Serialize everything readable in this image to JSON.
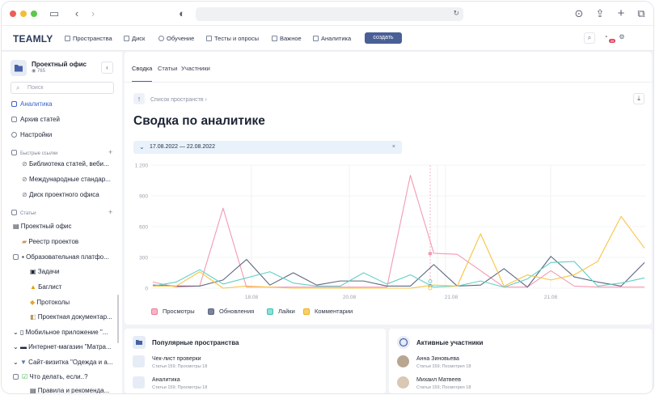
{
  "app": {
    "logo": "TEAMLY",
    "create": "создать"
  },
  "nav": [
    "Пространства",
    "Диск",
    "Обучение",
    "Тесты и опросы",
    "Важное",
    "Аналитика"
  ],
  "badge": "35",
  "sidebar": {
    "space_title": "Проектный офис",
    "space_views": "765",
    "search_placeholder": "Поиск",
    "analytics": "Аналитика",
    "archive": "Архив статей",
    "settings": "Настройки",
    "quick_links": "Быстрые ссылки",
    "links": [
      "Библиотека статей, веби...",
      "Международные стандар...",
      "Диск проектного офиса"
    ],
    "articles": "Статьи",
    "tree": [
      "Проектный офис",
      "Реестр проектов",
      "Образовательная платфо...",
      "Задачи",
      "Баглист",
      "Протоколы",
      "Проектная документар...",
      "Мобильное приложение \"...",
      "Интернет-магазин \"Матра...",
      "Сайт-визитка \"Одежда и а...",
      "Что делать, если..?",
      "Правила и рекоменда..."
    ]
  },
  "tabs": [
    "Сводка",
    "Статьи",
    "Участники"
  ],
  "breadcrumb": "Список пространств",
  "page_title": "Сводка по аналитике",
  "date_range": "17.08.2022 — 22.08.2022",
  "chart_data": {
    "type": "line",
    "ylim": [
      0,
      1200
    ],
    "yticks": [
      "1 200",
      "900",
      "600",
      "300",
      "0"
    ],
    "xticks": [
      "18.08",
      "20.08",
      "21.08",
      "21.08"
    ],
    "series": [
      {
        "name": "Просмотры",
        "color": "#f39ab2",
        "values": [
          60,
          10,
          20,
          780,
          10,
          10,
          10,
          10,
          10,
          10,
          10,
          1100,
          340,
          330,
          170,
          10,
          10,
          170,
          20,
          10,
          10,
          10
        ]
      },
      {
        "name": "Обновления",
        "color": "#5d6780",
        "values": [
          30,
          20,
          20,
          80,
          280,
          30,
          150,
          30,
          70,
          70,
          20,
          20,
          230,
          20,
          30,
          190,
          10,
          310,
          110,
          60,
          20,
          250
        ]
      },
      {
        "name": "Лайки",
        "color": "#63d0c4",
        "values": [
          20,
          60,
          180,
          40,
          100,
          160,
          50,
          20,
          20,
          150,
          40,
          130,
          10,
          20,
          70,
          10,
          90,
          250,
          260,
          20,
          50,
          100
        ]
      },
      {
        "name": "Комментарии",
        "color": "#f7c444",
        "values": [
          20,
          20,
          160,
          0,
          20,
          10,
          0,
          0,
          0,
          0,
          0,
          0,
          30,
          20,
          530,
          20,
          130,
          80,
          130,
          260,
          700,
          390
        ]
      }
    ]
  },
  "popular": {
    "title": "Популярные пространства",
    "items": [
      {
        "name": "Чек-лист проверки",
        "meta": "Статьи 159; Просмотры 18"
      },
      {
        "name": "Аналитика",
        "meta": "Статьи 159; Просмотры 18"
      }
    ]
  },
  "active": {
    "title": "Активные участники",
    "items": [
      {
        "name": "Анна Зиновьева",
        "meta": "Статьи 159; Посмотрел 18"
      },
      {
        "name": "Михаил Матвеев",
        "meta": "Статьи 159; Посмотрел 18"
      }
    ]
  }
}
